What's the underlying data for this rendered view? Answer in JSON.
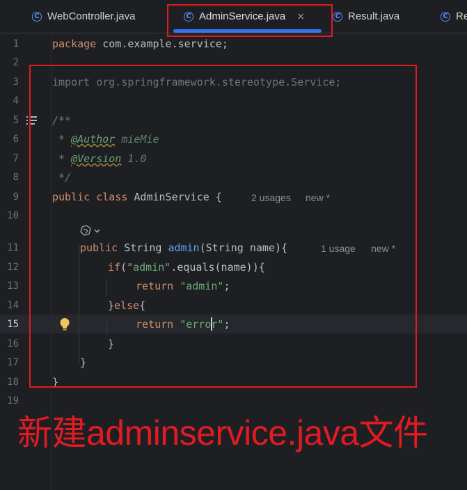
{
  "tabs": [
    {
      "label": "WebController.java",
      "icon": "class-icon",
      "active": false
    },
    {
      "label": "AdminService.java",
      "icon": "class-icon",
      "active": true,
      "close": "×"
    },
    {
      "label": "Result.java",
      "icon": "class-icon",
      "active": false
    },
    {
      "label": "Re",
      "icon": "class-icon",
      "active": false
    }
  ],
  "tab_icon_glyph": "C",
  "line_numbers": [
    "1",
    "2",
    "3",
    "4",
    "5",
    "6",
    "7",
    "8",
    "9",
    "10",
    "11",
    "12",
    "13",
    "14",
    "15",
    "16",
    "17",
    "18",
    "19"
  ],
  "current_line": "15",
  "code": {
    "l1": {
      "kw": "package",
      "rest": " com.example.service;"
    },
    "l3": "import org.springframework.stereotype.Service;",
    "l5": "/**",
    "l6": {
      "star": " * ",
      "tag": "@Author",
      "val": " mieMie"
    },
    "l7": {
      "star": " * ",
      "tag": "@Version",
      "val": " 1.0"
    },
    "l8": " */",
    "l9": {
      "kw": "public class",
      "rest": " AdminService {"
    },
    "l9_hints": [
      "2 usages",
      "new *"
    ],
    "l11": {
      "kw": "public",
      "type": " String ",
      "method": "admin",
      "rest": "(String name){"
    },
    "l11_hints": [
      "1 usage",
      "new *"
    ],
    "l12": {
      "kw": "if",
      "p1": "(",
      "str": "\"admin\"",
      "rest": ".equals(name)){"
    },
    "l13": {
      "kw": "return",
      "sp": " ",
      "str": "\"admin\"",
      "end": ";"
    },
    "l14": {
      "b1": "}",
      "kw": "else",
      "b2": "{"
    },
    "l15": {
      "kw": "return",
      "sp": " ",
      "str": "\"error\"",
      "end": ";"
    },
    "l16": "}",
    "l17": "}",
    "l18": "}"
  },
  "annotation": "新建adminservice.java文件",
  "colors": {
    "highlight": "#e01b24",
    "accent": "#3574f0",
    "keyword": "#cf8e6d",
    "string": "#6aab73",
    "method": "#56a8f5"
  }
}
